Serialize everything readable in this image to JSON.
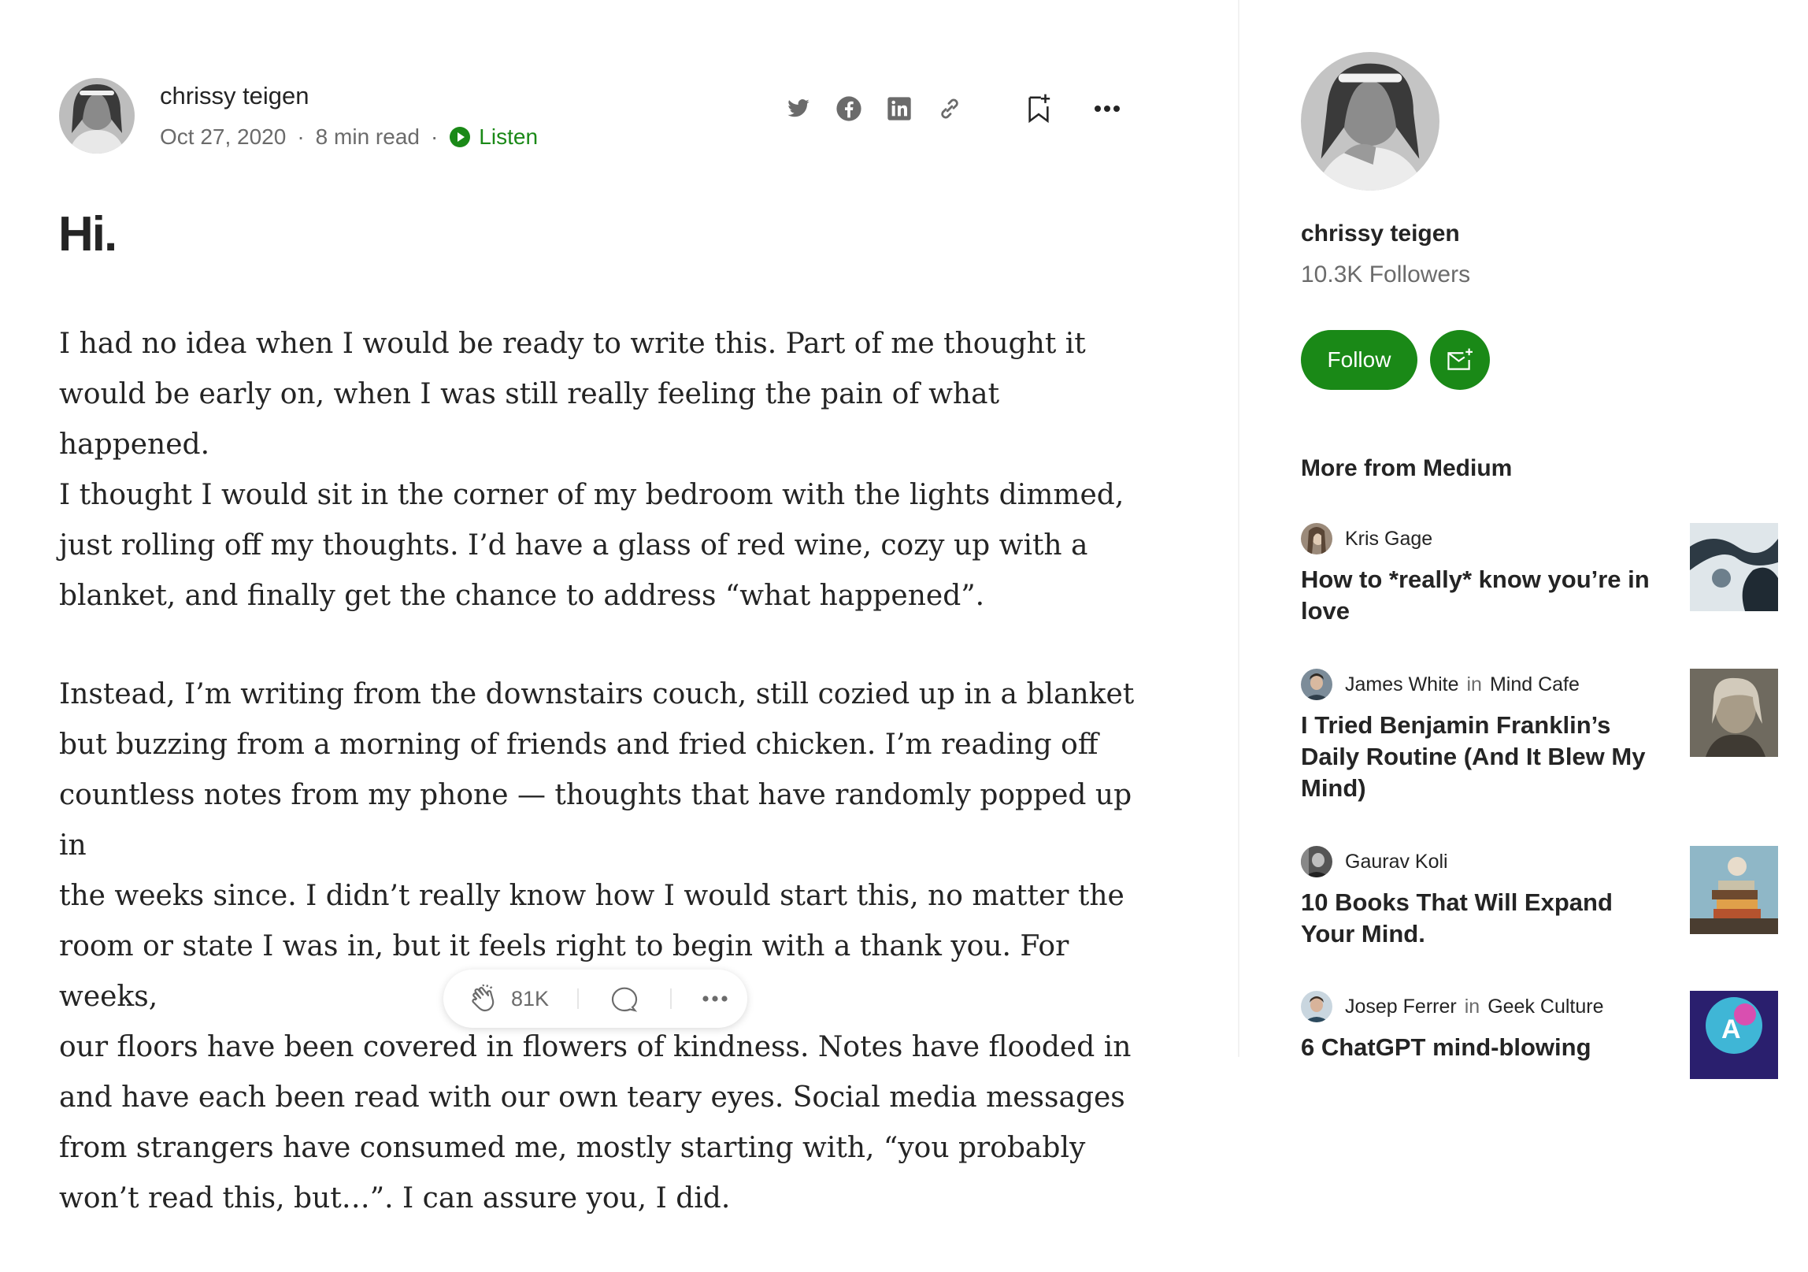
{
  "article": {
    "author": "chrissy teigen",
    "date": "Oct 27, 2020",
    "read_time": "8 min read",
    "dot": "·",
    "listen_label": "Listen",
    "title": "Hi.",
    "paragraphs": [
      "I had no idea when I would be ready to write this. Part of me thought it\nwould be early on, when I was still really feeling the pain of what happened.\nI thought I would sit in the corner of my bedroom with the lights dimmed,\njust rolling off my thoughts. I’d have a glass of red wine, cozy up with a\nblanket, and finally get the chance to address “what happened”.",
      "Instead, I’m writing from the downstairs couch, still cozied up in a blanket\nbut buzzing from a morning of friends and fried chicken. I’m reading off\ncountless notes from my phone — thoughts that have randomly popped up in\nthe weeks since. I didn’t really know how I would start this, no matter the\nroom or state I was in, but it feels right to begin with a thank you. For weeks,\nour floors have been covered in flowers of kindness. Notes have flooded in\nand have each been read with our own teary eyes. Social media messages\nfrom strangers have consumed me, mostly starting with, “you probably\nwon’t read this, but…”. I can assure you, I did."
    ],
    "claps": "81K",
    "icons": [
      "twitter-icon",
      "facebook-icon",
      "linkedin-icon",
      "link-icon",
      "bookmark-icon",
      "more-icon"
    ]
  },
  "sidebar": {
    "author": "chrissy teigen",
    "followers": "10.3K Followers",
    "follow_label": "Follow",
    "more_from": "More from Medium",
    "recommendations": [
      {
        "author": "Kris Gage",
        "in": "",
        "publication": "",
        "title": "How to *really* know you’re in love"
      },
      {
        "author": "James White",
        "in": "in",
        "publication": "Mind Cafe",
        "title": "I Tried Benjamin Franklin’s Daily Routine (And It Blew My Mind)"
      },
      {
        "author": "Gaurav Koli",
        "in": "",
        "publication": "",
        "title": "10 Books That Will Expand Your Mind."
      },
      {
        "author": "Josep Ferrer",
        "in": "in",
        "publication": "Geek Culture",
        "title": "6 ChatGPT mind-blowing"
      }
    ]
  },
  "colors": {
    "accent": "#1a8917",
    "text": "#242424",
    "muted": "#6b6b6b"
  }
}
